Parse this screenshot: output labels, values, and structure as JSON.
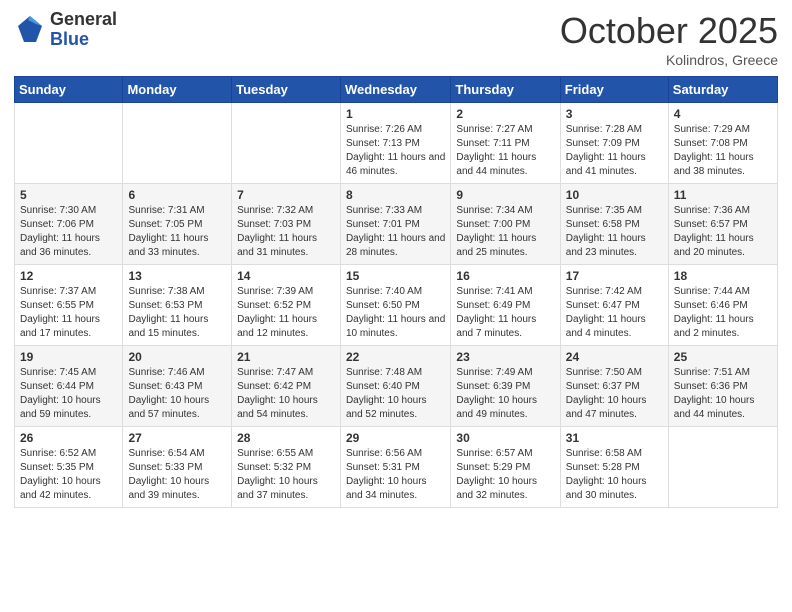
{
  "logo": {
    "general": "General",
    "blue": "Blue"
  },
  "title": "October 2025",
  "subtitle": "Kolindros, Greece",
  "days_header": [
    "Sunday",
    "Monday",
    "Tuesday",
    "Wednesday",
    "Thursday",
    "Friday",
    "Saturday"
  ],
  "weeks": [
    [
      {
        "day": "",
        "info": ""
      },
      {
        "day": "",
        "info": ""
      },
      {
        "day": "",
        "info": ""
      },
      {
        "day": "1",
        "info": "Sunrise: 7:26 AM\nSunset: 7:13 PM\nDaylight: 11 hours\nand 46 minutes."
      },
      {
        "day": "2",
        "info": "Sunrise: 7:27 AM\nSunset: 7:11 PM\nDaylight: 11 hours\nand 44 minutes."
      },
      {
        "day": "3",
        "info": "Sunrise: 7:28 AM\nSunset: 7:09 PM\nDaylight: 11 hours\nand 41 minutes."
      },
      {
        "day": "4",
        "info": "Sunrise: 7:29 AM\nSunset: 7:08 PM\nDaylight: 11 hours\nand 38 minutes."
      }
    ],
    [
      {
        "day": "5",
        "info": "Sunrise: 7:30 AM\nSunset: 7:06 PM\nDaylight: 11 hours\nand 36 minutes."
      },
      {
        "day": "6",
        "info": "Sunrise: 7:31 AM\nSunset: 7:05 PM\nDaylight: 11 hours\nand 33 minutes."
      },
      {
        "day": "7",
        "info": "Sunrise: 7:32 AM\nSunset: 7:03 PM\nDaylight: 11 hours\nand 31 minutes."
      },
      {
        "day": "8",
        "info": "Sunrise: 7:33 AM\nSunset: 7:01 PM\nDaylight: 11 hours\nand 28 minutes."
      },
      {
        "day": "9",
        "info": "Sunrise: 7:34 AM\nSunset: 7:00 PM\nDaylight: 11 hours\nand 25 minutes."
      },
      {
        "day": "10",
        "info": "Sunrise: 7:35 AM\nSunset: 6:58 PM\nDaylight: 11 hours\nand 23 minutes."
      },
      {
        "day": "11",
        "info": "Sunrise: 7:36 AM\nSunset: 6:57 PM\nDaylight: 11 hours\nand 20 minutes."
      }
    ],
    [
      {
        "day": "12",
        "info": "Sunrise: 7:37 AM\nSunset: 6:55 PM\nDaylight: 11 hours\nand 17 minutes."
      },
      {
        "day": "13",
        "info": "Sunrise: 7:38 AM\nSunset: 6:53 PM\nDaylight: 11 hours\nand 15 minutes."
      },
      {
        "day": "14",
        "info": "Sunrise: 7:39 AM\nSunset: 6:52 PM\nDaylight: 11 hours\nand 12 minutes."
      },
      {
        "day": "15",
        "info": "Sunrise: 7:40 AM\nSunset: 6:50 PM\nDaylight: 11 hours\nand 10 minutes."
      },
      {
        "day": "16",
        "info": "Sunrise: 7:41 AM\nSunset: 6:49 PM\nDaylight: 11 hours\nand 7 minutes."
      },
      {
        "day": "17",
        "info": "Sunrise: 7:42 AM\nSunset: 6:47 PM\nDaylight: 11 hours\nand 4 minutes."
      },
      {
        "day": "18",
        "info": "Sunrise: 7:44 AM\nSunset: 6:46 PM\nDaylight: 11 hours\nand 2 minutes."
      }
    ],
    [
      {
        "day": "19",
        "info": "Sunrise: 7:45 AM\nSunset: 6:44 PM\nDaylight: 10 hours\nand 59 minutes."
      },
      {
        "day": "20",
        "info": "Sunrise: 7:46 AM\nSunset: 6:43 PM\nDaylight: 10 hours\nand 57 minutes."
      },
      {
        "day": "21",
        "info": "Sunrise: 7:47 AM\nSunset: 6:42 PM\nDaylight: 10 hours\nand 54 minutes."
      },
      {
        "day": "22",
        "info": "Sunrise: 7:48 AM\nSunset: 6:40 PM\nDaylight: 10 hours\nand 52 minutes."
      },
      {
        "day": "23",
        "info": "Sunrise: 7:49 AM\nSunset: 6:39 PM\nDaylight: 10 hours\nand 49 minutes."
      },
      {
        "day": "24",
        "info": "Sunrise: 7:50 AM\nSunset: 6:37 PM\nDaylight: 10 hours\nand 47 minutes."
      },
      {
        "day": "25",
        "info": "Sunrise: 7:51 AM\nSunset: 6:36 PM\nDaylight: 10 hours\nand 44 minutes."
      }
    ],
    [
      {
        "day": "26",
        "info": "Sunrise: 6:52 AM\nSunset: 5:35 PM\nDaylight: 10 hours\nand 42 minutes."
      },
      {
        "day": "27",
        "info": "Sunrise: 6:54 AM\nSunset: 5:33 PM\nDaylight: 10 hours\nand 39 minutes."
      },
      {
        "day": "28",
        "info": "Sunrise: 6:55 AM\nSunset: 5:32 PM\nDaylight: 10 hours\nand 37 minutes."
      },
      {
        "day": "29",
        "info": "Sunrise: 6:56 AM\nSunset: 5:31 PM\nDaylight: 10 hours\nand 34 minutes."
      },
      {
        "day": "30",
        "info": "Sunrise: 6:57 AM\nSunset: 5:29 PM\nDaylight: 10 hours\nand 32 minutes."
      },
      {
        "day": "31",
        "info": "Sunrise: 6:58 AM\nSunset: 5:28 PM\nDaylight: 10 hours\nand 30 minutes."
      },
      {
        "day": "",
        "info": ""
      }
    ]
  ]
}
